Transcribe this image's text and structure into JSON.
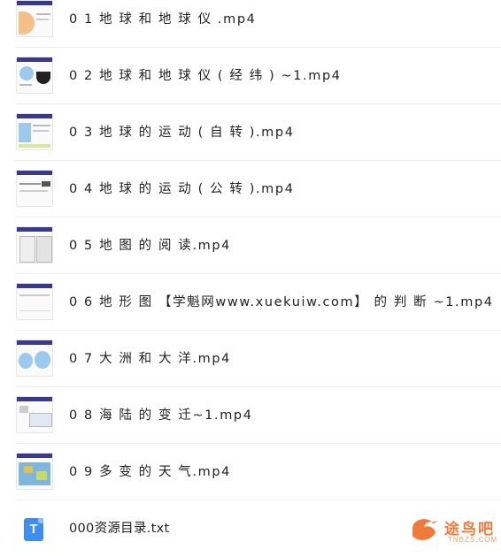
{
  "files": [
    {
      "name": "0 1 地 球 和 地 球 仪 .mp4",
      "icon": "video-thumbnail"
    },
    {
      "name": "0 2 地 球 和 地 球 仪 ( 经 纬 ) ~1.mp4",
      "icon": "video-thumbnail"
    },
    {
      "name": "0 3 地 球 的 运 动 ( 自 转 ).mp4",
      "icon": "video-thumbnail"
    },
    {
      "name": "0 4 地 球 的 运 动 ( 公 转 ).mp4",
      "icon": "video-thumbnail"
    },
    {
      "name": "0 5 地 图 的 阅 读.mp4",
      "icon": "video-thumbnail"
    },
    {
      "name": "0 6 地 形 图 【学魁网www.xuekuiw.com】 的 判 断 ~1.mp4",
      "icon": "video-thumbnail"
    },
    {
      "name": "0 7 大 洲 和 大 洋.mp4",
      "icon": "video-thumbnail"
    },
    {
      "name": "0 8 海 陆 的 变 迁~1.mp4",
      "icon": "video-thumbnail"
    },
    {
      "name": "0 9 多 变 的 天 气.mp4",
      "icon": "video-thumbnail"
    },
    {
      "name": "000资源目录.txt",
      "icon": "txt-file-icon",
      "icon_letter": "T"
    }
  ],
  "watermark": {
    "text": "途鸟吧",
    "sub": "TNBZS.COM"
  },
  "colors": {
    "accent": "#3c8cf2",
    "thumb_header": "#3a3a8c",
    "watermark": "#f07a3a"
  }
}
